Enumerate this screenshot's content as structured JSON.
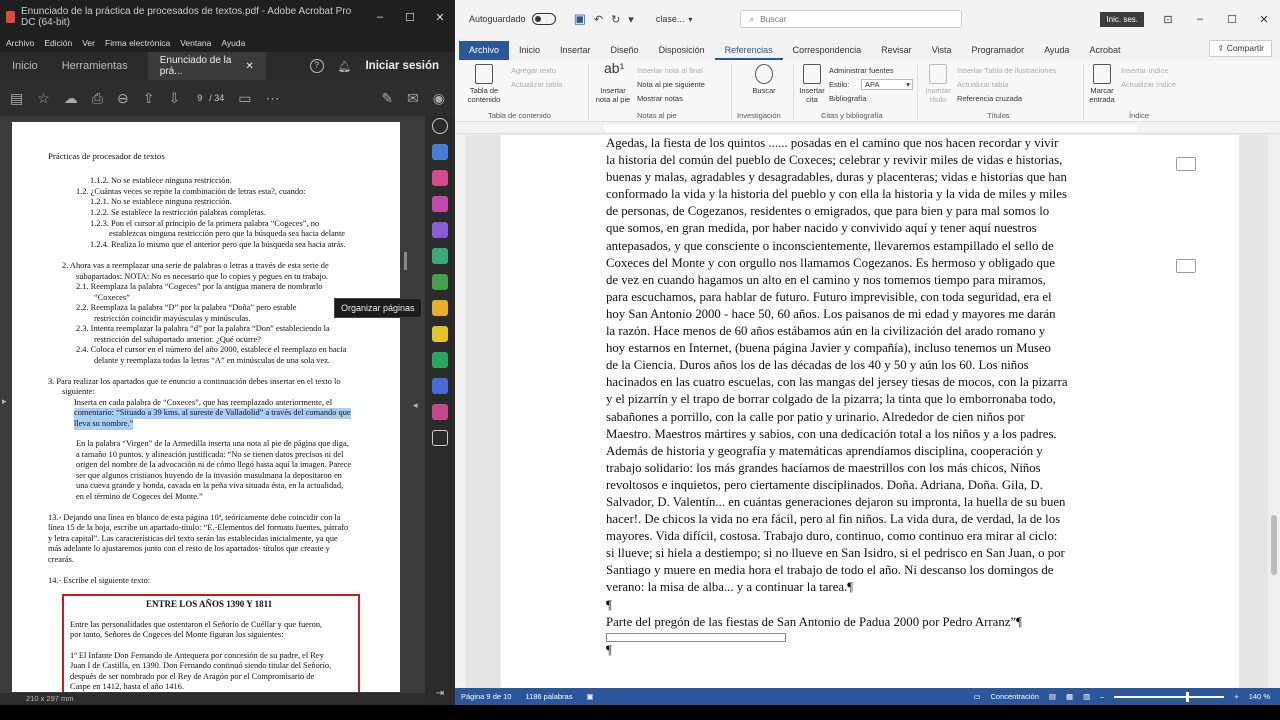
{
  "acrobat": {
    "title": "Enunciado de la práctica de procesados de textos.pdf - Adobe Acrobat Pro DC (64-bit)",
    "menu": [
      "Archivo",
      "Edición",
      "Ver",
      "Firma electrónica",
      "Ventana",
      "Ayuda"
    ],
    "tabs": {
      "home": "Inicio",
      "tools": "Herramientas",
      "doc": "Enunciado de la prá..."
    },
    "signin": "Iniciar sesión",
    "page_current": "9",
    "page_total": "/ 34",
    "tooltip": "Organizar páginas",
    "page_size": "210 x 297 mm",
    "pdf_lines": [
      "Prácticas de procesador de textos",
      "1.1.2.   No se establece ninguna restricción.",
      "1.2. ¿Cuántas veces se repite la combinación de letras esta?, cuando:",
      "1.2.1.   No se establece ninguna restricción.",
      "1.2.2.   Se establece la restricción palabras completas.",
      "1.2.3.   Pon el cursor al principio de la primera palabra “Cogeces”, no",
      "establezcas ninguna restricción pero que la búsqueda sea hacia delante",
      "1.2.4.   Realiza lo mismo que el anterior pero que la búsqueda sea hacia atrás.",
      "2.   Ahora vas a reemplazar una serie de palabras o letras a través de esta serie de",
      "subapartados: NOTA: No es necesario que lo copies y pegues en tu trabajo.",
      "2.1. Reemplaza la palabra “Cogeces” por la antigua manera de nombrarlo",
      "“Coxeces”",
      "2.2. Reemplaza la palabra “D” por la palabra “Doña” pero estable",
      "restricción coincidir mayúsculas y minúsculas.",
      "2.3. Intenta reemplazar la palabra “d” por la palabra “Don” estableciendo la",
      "restricción del subapartado anterior. ¿Qué ocurre?",
      "2.4. Coloca el cursor en el número del año 2000, establece el reemplazo en hacia",
      "delante y reemplaza todas la letras “A” en minúsculas de una sola vez.",
      "3.   Para realizar los apartados que te enuncio a continuación debes insertar en el texto lo",
      "siguiente:",
      "Inserta en cada palabra de “Coxeces”, que has reemplazado anteriormente, el",
      "comentario: “Situado a 39 kms. al sureste de Valladolid” a través del comando que",
      "lleva su nombre.”",
      "En la palabra “Virgen” de la Armedilla inserta una nota al pie de página que diga,",
      "a tamaño 10 puntos. y alineación justificada: “No se tienen datos precisos ni del",
      "origen del nombre de la advocación ni de cómo llegó hasta aquí la imagen. Parece",
      "ser que algunos cristianos huyendo de la invasión musulmana la depositaron en",
      "una cueva grande y honda, cavada en la peña viva situada ésta, en la actualidad,",
      "en el término de Cogeces del Monte.”",
      "13.- Dejando una línea en blanco de esta página 10ª, teóricamente debe coincidir con la",
      "línea 15 de la hoja, escribe un apartado-título: “E.-Elementos del formato fuentes, párrafo",
      "y letra capital”. Las características del texto serán las establecidas inicialmente, ya que",
      "más adelante lo ajustaremos junto con el resto de los apartados- títulos que creaste y",
      "crearás.",
      "14.- Escribe el siguiente texto:",
      "ENTRE LOS AÑOS 1390 Y 1811",
      "Entre las personalidades que ostentaron el Señorío de Cuéllar y que fueron,",
      "por tanto, Señores de Cogeces del Monte figuran los siguientes:",
      "1º El Infante Don Fernando de Antequera por concesión de su padre, el Rey",
      "Juan I de Castilla, en 1390. Don Fernando continuó siendo titular del Señorío,",
      "después de ser nombrado por el Rey de Aragón por el Compromisario de",
      "Caspe en 1412, hasta el año 1416."
    ]
  },
  "word": {
    "autosave": "Autoguardado",
    "doc_name": "clase...",
    "search_placeholder": "Buscar",
    "signin": "Inic. ses.",
    "tabs": [
      "Archivo",
      "Inicio",
      "Insertar",
      "Diseño",
      "Disposición",
      "Referencias",
      "Correspondencia",
      "Revisar",
      "Vista",
      "Programador",
      "Ayuda",
      "Acrobat"
    ],
    "share": "Compartir",
    "ribbon": {
      "toc_button": "Tabla de contenido",
      "add_text": "Agregar texto",
      "update_table": "Actualizar tabla",
      "group_toc": "Tabla de contenido",
      "insert_footnote": "Insertar nota al pie",
      "insert_endnote": "Insertar nota al final",
      "next_footnote": "Nota al pie siguiente",
      "show_notes": "Mostrar notas",
      "group_footnotes": "Notas al pie",
      "search": "Buscar",
      "group_research": "Investigación",
      "insert_citation": "Insertar cita",
      "manage_sources": "Administrar fuentes",
      "style_label": "Estilo:",
      "style_value": "APA",
      "bibliography": "Bibliografía",
      "group_citations": "Citas y bibliografía",
      "insert_caption": "Insertar título",
      "insert_table_figures": "Insertar Tabla de ilustraciones",
      "update_table2": "Actualizar tabla",
      "cross_reference": "Referencia cruzada",
      "group_captions": "Títulos",
      "mark_entry": "Marcar entrada",
      "insert_index": "Insertar índice",
      "update_index": "Actualizar índice",
      "group_index": "Índice"
    },
    "doc_lines": [
      "Agedas, la fiesta de los quintos ...... posadas en el camino que nos hacen recordar y vivir",
      "la historia del común del pueblo de Coxeces; celebrar y revivir miles de vidas e historias,",
      "buenas y malas, agradables y desagradables, duras y placenteras; vidas e historias que han",
      "conformado la vida y la historia del pueblo y con ella la historia y la vida de miles y miles",
      "de personas, de Cogezanos, residentes o emigrados, que para bien y para mal somos lo",
      "que somos, en gran medida, por haber nacido y convivido aquí y tener aquí nuestros",
      "antepasados, y que consciente o inconscientemente, llevaremos estampillado el sello de",
      "Coxeces del Monte y con orgullo nos llamamos Cogezanos. Es hermoso y obligado que",
      "de vez en cuando hagamos un alto en el camino y nos tomemos tiempo para miramos,",
      "para escuchamos, para hablar de futuro. Futuro imprevisible, con toda seguridad, era el",
      "hoy San Antonio 2000 - hace 50, 60 años. Los paisanos de mi edad y mayores me darán",
      "la razón. Hace menos de 60 años estábamos aún en la civilización del arado romano y",
      "hoy estarnos en Internet, (buena página Javier y compañía), incluso tenemos un Museo",
      "de la Ciencia. Duros años los de las décadas de los 40 y 50 y aún los 60. Los niños",
      "hacinados en las cuatro escuelas, con las mangas del jersey tiesas de mocos, con la pizarra",
      "y el pizarrín y el trapo de borrar colgado de la pizarra; la tinta que lo emborronaba todo,",
      "sabañones a porrillo, con la calle por patio y urinario. Alrededor de cien niños por",
      "Maestro. Maestros mártires y sabios, con una dedicación total a los niños y a los padres.",
      "Además de historia y geografía y matemáticas aprendíamos disciplina, cooperación y",
      "trabajo solidario: los más grandes hacíamos de maestrillos con los más chicos, Niños",
      "revoltosos e inquietos, pero ciertamente disciplinados. Doña. Adriana, Doña. Gila, D.",
      "Salvador, D. Valentín... en cuántas generaciones dejaron su impronta, la huella de su buen",
      "hacer!. De chicos la vida no era fácil, pero al fin niños. La vida dura, de verdad, la de los",
      "mayores. Vida difícil, costosa. Trabajo duro, continuo, como continuo era mirar al ciclo:",
      "si llueve; si hiela a destiempo; si no llueve en San Isidro, si el pedrisco en San Juan, o por",
      "Santiago y muere en media hora el trabajo de todo el año. Ni descanso los domingos de",
      "verano: la misa de alba... y a continuar la tarea.¶"
    ],
    "pilcrow": "¶",
    "closing_line": "Parte del pregón de las fiestas de San Antonio de Padua 2000 por Pedro Arranz”¶",
    "status": {
      "page": "Página 9 de 10",
      "words": "1186 palabras",
      "focus": "Concentración",
      "zoom": "140 %"
    }
  }
}
